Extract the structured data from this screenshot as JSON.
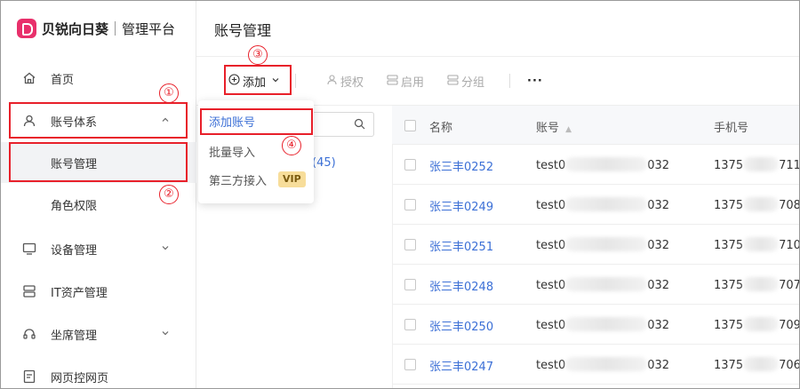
{
  "brand": {
    "name": "贝锐向日葵",
    "subtitle": "管理平台",
    "accent": "#e8306b"
  },
  "sidebar": {
    "items": [
      {
        "label": "首页",
        "icon": "home-icon"
      },
      {
        "label": "账号体系",
        "icon": "user-icon",
        "expanded": true
      },
      {
        "label": "账号管理",
        "sub": true,
        "active": true
      },
      {
        "label": "角色权限",
        "sub": true
      },
      {
        "label": "设备管理",
        "icon": "monitor-icon"
      },
      {
        "label": "IT资产管理",
        "icon": "server-icon"
      },
      {
        "label": "坐席管理",
        "icon": "headset-icon"
      },
      {
        "label": "网页控网页",
        "icon": "web-icon"
      }
    ]
  },
  "page": {
    "title": "账号管理"
  },
  "toolbar": {
    "add": "添加",
    "authorize": "授权",
    "enable": "启用",
    "group": "分组",
    "more": "···"
  },
  "dropdown": {
    "items": [
      {
        "label": "添加账号",
        "active": true
      },
      {
        "label": "批量导入"
      },
      {
        "label": "第三方接入",
        "badge": "VIP"
      }
    ]
  },
  "left_panel": {
    "group_count": "(45)"
  },
  "table": {
    "headers": {
      "name": "名称",
      "account": "账号",
      "phone": "手机号"
    },
    "rows": [
      {
        "name": "张三丰0252",
        "acc_prefix": "test0",
        "acc_suffix": "032",
        "phone_prefix": "1375",
        "phone_suffix": "711"
      },
      {
        "name": "张三丰0249",
        "acc_prefix": "test0",
        "acc_suffix": "032",
        "phone_prefix": "1375",
        "phone_suffix": "708"
      },
      {
        "name": "张三丰0251",
        "acc_prefix": "test0",
        "acc_suffix": "032",
        "phone_prefix": "1375",
        "phone_suffix": "710"
      },
      {
        "name": "张三丰0248",
        "acc_prefix": "test0",
        "acc_suffix": "032",
        "phone_prefix": "1375",
        "phone_suffix": "707"
      },
      {
        "name": "张三丰0250",
        "acc_prefix": "test0",
        "acc_suffix": "032",
        "phone_prefix": "1375",
        "phone_suffix": "709"
      },
      {
        "name": "张三丰0247",
        "acc_prefix": "test0",
        "acc_suffix": "032",
        "phone_prefix": "1375",
        "phone_suffix": "706"
      }
    ]
  },
  "annotations": {
    "n1": "①",
    "n2": "②",
    "n3": "③",
    "n4": "④",
    "color": "#e8202a"
  }
}
